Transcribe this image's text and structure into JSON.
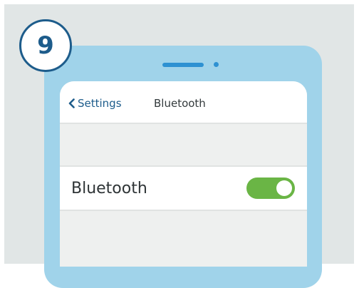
{
  "step": {
    "number": "9"
  },
  "nav": {
    "back_label": "Settings",
    "title": "Bluetooth"
  },
  "bluetooth_row": {
    "label": "Bluetooth",
    "toggle_on": true
  },
  "colors": {
    "accent_blue": "#1d5c8b",
    "phone_body": "#a0d3ea",
    "toggle_on": "#6ab545",
    "background": "#e1e6e6"
  },
  "icons": {
    "back": "chevron-left-icon"
  }
}
